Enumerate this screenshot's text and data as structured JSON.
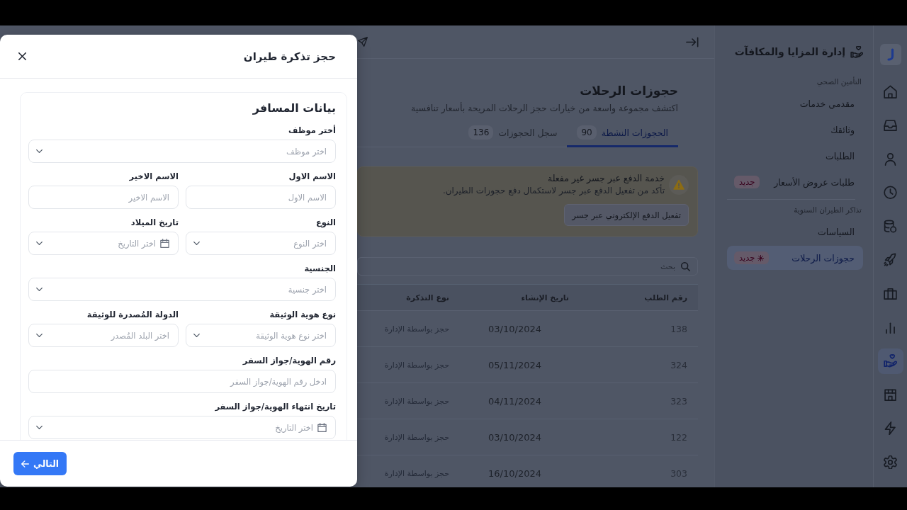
{
  "rail": {
    "items": [
      {
        "selected": false
      },
      {
        "selected": false
      },
      {
        "selected": false
      },
      {
        "selected": false
      },
      {
        "selected": false
      },
      {
        "selected": false
      },
      {
        "selected": false
      },
      {
        "selected": false
      },
      {
        "selected": true
      },
      {
        "selected": false
      },
      {
        "selected": false
      },
      {
        "selected": false
      }
    ]
  },
  "sidebar": {
    "title": "إدارة المزايا والمكافآت",
    "groups": [
      {
        "heading": "التأمين الصحي",
        "items": [
          {
            "label": "مقدمي خدمات",
            "selected": false
          },
          {
            "label": "وثائقك",
            "selected": false
          },
          {
            "label": "الطلبات",
            "selected": false
          },
          {
            "label": "طلبات عروض الأسعار",
            "selected": false,
            "badge": "جديد",
            "badge_icon": false
          }
        ]
      },
      {
        "heading": "تذاكر الطيران السنوية",
        "items": [
          {
            "label": "السياسات",
            "selected": false
          },
          {
            "label": "حجوزات الرحلات",
            "selected": true,
            "badge": "جديد",
            "badge_icon": true
          }
        ]
      }
    ]
  },
  "main": {
    "title": "حجوزات الرحلات",
    "subtitle": "اكتشف مجموعة واسعة من خيارات حجز الرحلات المريحة بأسعار تنافسية",
    "tabs": [
      {
        "label": "الحجوزات النشطة",
        "count": "90",
        "selected": true
      },
      {
        "label": "سجل الحجوزات",
        "count": "136",
        "selected": false
      }
    ],
    "alert": {
      "title": "خدمة الدفع عبر جسر غير مفعلة",
      "message": "تأكد من تفعيل الدفع عبر جسر لاستكمال دفع حجوزات الطيران.",
      "button": "تفعيل الدفع الإلكتروني عبر جسر"
    },
    "search": {
      "placeholder": "بحث"
    },
    "table": {
      "columns": [
        "رقم الطلب",
        "تاريخ الإنشاء",
        "نوع التذكرة"
      ],
      "rows": [
        [
          "138",
          "03/10/2024",
          "حجز بواسطة الإدارة"
        ],
        [
          "324",
          "05/11/2024",
          "حجز بواسطة الإدارة"
        ],
        [
          "323",
          "04/11/2024",
          "حجز بواسطة الإدارة"
        ],
        [
          "122",
          "03/10/2024",
          "حجز بواسطة الإدارة"
        ],
        [
          "303",
          "16/10/2024",
          "حجز بواسطة الإدارة"
        ]
      ]
    }
  },
  "modal": {
    "title": "حجز تذكرة طيران",
    "section_title": "بيانات المسافر",
    "rows": [
      [
        {
          "kind": "select",
          "label": "أختر موظف",
          "placeholder": "اختر موظف"
        }
      ],
      [
        {
          "kind": "text",
          "label": "الاسم الاول",
          "placeholder": "الاسم الاول"
        },
        {
          "kind": "text",
          "label": "الاسم الاخير",
          "placeholder": "الاسم الاخير"
        }
      ],
      [
        {
          "kind": "select",
          "label": "النوع",
          "placeholder": "اختر النوع"
        },
        {
          "kind": "date",
          "label": "تاريخ الميلاد",
          "placeholder": "اختر التاريخ"
        }
      ],
      [
        {
          "kind": "select",
          "label": "الجنسية",
          "placeholder": "اختر جنسية"
        }
      ],
      [
        {
          "kind": "select",
          "label": "نوع هوية الوثيقة",
          "placeholder": "اختر نوع هوية الوثيقة"
        },
        {
          "kind": "select",
          "label": "الدولة المُصدرة للوثيقة",
          "placeholder": "اختر البلد المُصدر"
        }
      ],
      [
        {
          "kind": "text",
          "label": "رقم الهوية/جواز السفر",
          "placeholder": "ادخل رقم الهوية/جواز السفر"
        }
      ],
      [
        {
          "kind": "date",
          "label": "تاريخ انتهاء الهوية/جواز السفر",
          "placeholder": "اختر التاريخ"
        }
      ]
    ],
    "next_button": "التالي"
  }
}
